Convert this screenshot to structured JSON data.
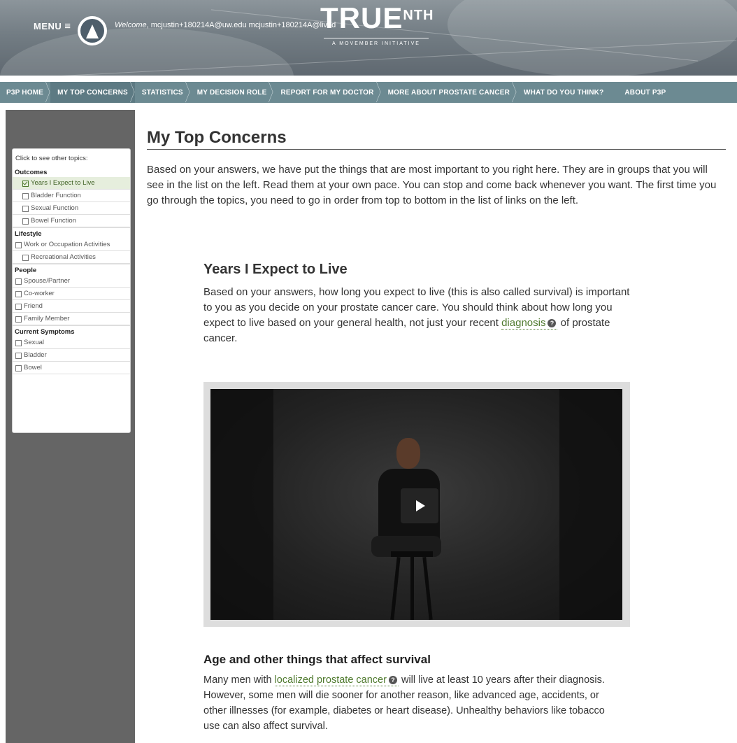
{
  "header": {
    "menu_label": "MENU",
    "welcome_prefix": "Welcome",
    "welcome_rest": ", mcjustin+180214A@uw.edu mcjustin+180214A@lived",
    "logo_word": "TRUE",
    "logo_sup": "NTH",
    "logo_tagline": "A MOVEMBER INITIATIVE"
  },
  "nav": {
    "items": [
      {
        "label": "P3P HOME"
      },
      {
        "label": "MY TOP CONCERNS"
      },
      {
        "label": "STATISTICS"
      },
      {
        "label": "MY DECISION ROLE"
      },
      {
        "label": "REPORT FOR MY DOCTOR"
      },
      {
        "label": "MORE ABOUT PROSTATE CANCER"
      },
      {
        "label": "WHAT DO YOU THINK?"
      },
      {
        "label": "ABOUT P3P"
      }
    ]
  },
  "sidebar": {
    "hint": "Click to see other topics:",
    "groups": [
      {
        "title": "Outcomes",
        "items": [
          {
            "label": "Years I Expect to Live",
            "checked": true
          },
          {
            "label": "Bladder Function"
          },
          {
            "label": "Sexual Function"
          },
          {
            "label": "Bowel Function"
          }
        ]
      },
      {
        "title": "Lifestyle",
        "items": [
          {
            "label": "Work or Occupation Activities"
          },
          {
            "label": "Recreational Activities"
          }
        ]
      },
      {
        "title": "People",
        "items": [
          {
            "label": "Spouse/Partner"
          },
          {
            "label": "Co-worker"
          },
          {
            "label": "Friend"
          },
          {
            "label": "Family Member"
          }
        ]
      },
      {
        "title": "Current Symptoms",
        "items": [
          {
            "label": "Sexual"
          },
          {
            "label": "Bladder"
          },
          {
            "label": "Bowel"
          }
        ]
      }
    ]
  },
  "main": {
    "title": "My Top Concerns",
    "intro": "Based on your answers, we have put the things that are most important to you right here. They are in groups that you will see in the list on the left. Read them at your own pace. You can stop and come back whenever you want. The first time you go through the topics, you need to go in order from top to bottom in the list of links on the left."
  },
  "section": {
    "title": "Years I Expect to Live",
    "text_before": "Based on your answers, how long you expect to live (this is also called survival) is important to you as you decide on your prostate cancer care. You should think about how long you expect to live based on your general health, not just your recent ",
    "link": "diagnosis",
    "text_after": " of prostate cancer."
  },
  "subsection": {
    "title": "Age and other things that affect survival",
    "text_before": "Many men with ",
    "link": "localized prostate cancer",
    "text_after": " will live at least 10 years after their diagnosis. However, some men will die sooner for another reason, like advanced age, accidents, or other illnesses (for example, diabetes or heart disease). Unhealthy behaviors like tobacco use can also affect survival."
  }
}
